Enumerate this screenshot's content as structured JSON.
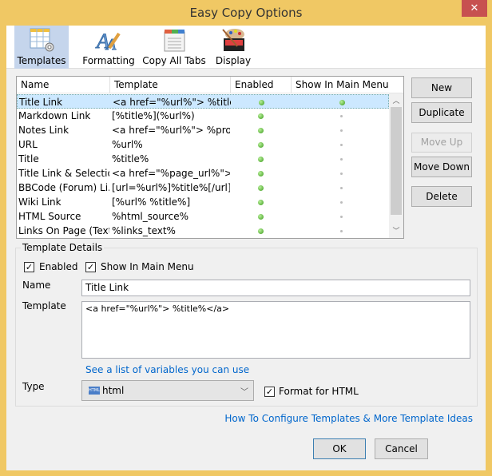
{
  "window": {
    "title": "Easy Copy Options",
    "close_icon": "close-icon"
  },
  "toolbar": [
    {
      "label": "Templates",
      "icon": "templates-table-gear-icon",
      "selected": true
    },
    {
      "label": "Formatting",
      "icon": "formatting-pen-icon",
      "selected": false
    },
    {
      "label": "Copy All Tabs",
      "icon": "tabs-window-icon",
      "selected": false
    },
    {
      "label": "Display",
      "icon": "palette-icon",
      "selected": false
    }
  ],
  "table": {
    "columns": [
      "Name",
      "Template",
      "Enabled",
      "Show In Main Menu"
    ],
    "rows": [
      {
        "name": "Title Link",
        "template": "<a href=\"%url%\"> %title...",
        "enabled": true,
        "main_menu": true,
        "selected": true
      },
      {
        "name": "Markdown Link",
        "template": "[%title%](%url%)",
        "enabled": true,
        "main_menu": false
      },
      {
        "name": "Notes Link",
        "template": "<a href=\"%url%\"> %prom...",
        "enabled": true,
        "main_menu": false
      },
      {
        "name": "URL",
        "template": "%url%",
        "enabled": true,
        "main_menu": false
      },
      {
        "name": "Title",
        "template": "%title%",
        "enabled": true,
        "main_menu": false
      },
      {
        "name": "Title Link & Selection",
        "template": "<a href=\"%page_url%\">...",
        "enabled": true,
        "main_menu": false
      },
      {
        "name": "BBCode (Forum) Li...",
        "template": "[url=%url%]%title%[/url]",
        "enabled": true,
        "main_menu": false
      },
      {
        "name": "Wiki Link",
        "template": "[%url% %title%]",
        "enabled": true,
        "main_menu": false
      },
      {
        "name": "HTML Source",
        "template": "%html_source%",
        "enabled": true,
        "main_menu": false
      },
      {
        "name": "Links On Page (Text)",
        "template": "%links_text%",
        "enabled": true,
        "main_menu": false
      }
    ]
  },
  "side_buttons": {
    "new": "New",
    "duplicate": "Duplicate",
    "move_up": "Move Up",
    "move_down": "Move Down",
    "delete": "Delete"
  },
  "details": {
    "group_title": "Template Details",
    "enabled_label": "Enabled",
    "enabled_checked": true,
    "show_main_label": "Show In Main Menu",
    "show_main_checked": true,
    "name_label": "Name",
    "name_value": "Title Link",
    "template_label": "Template",
    "template_value": "<a href=\"%url%\"> %title%</a>",
    "variables_link": "See a list of variables you can use",
    "type_label": "Type",
    "type_value": "html",
    "type_icon": "html-file-icon",
    "format_html_label": "Format for HTML",
    "format_html_checked": true
  },
  "footer": {
    "help_link": "How To Configure Templates & More Template Ideas",
    "ok": "OK",
    "cancel": "Cancel"
  },
  "colors": {
    "frame": "#f0c864",
    "selection": "#cce8ff",
    "link": "#0066cc",
    "close": "#c75050"
  }
}
